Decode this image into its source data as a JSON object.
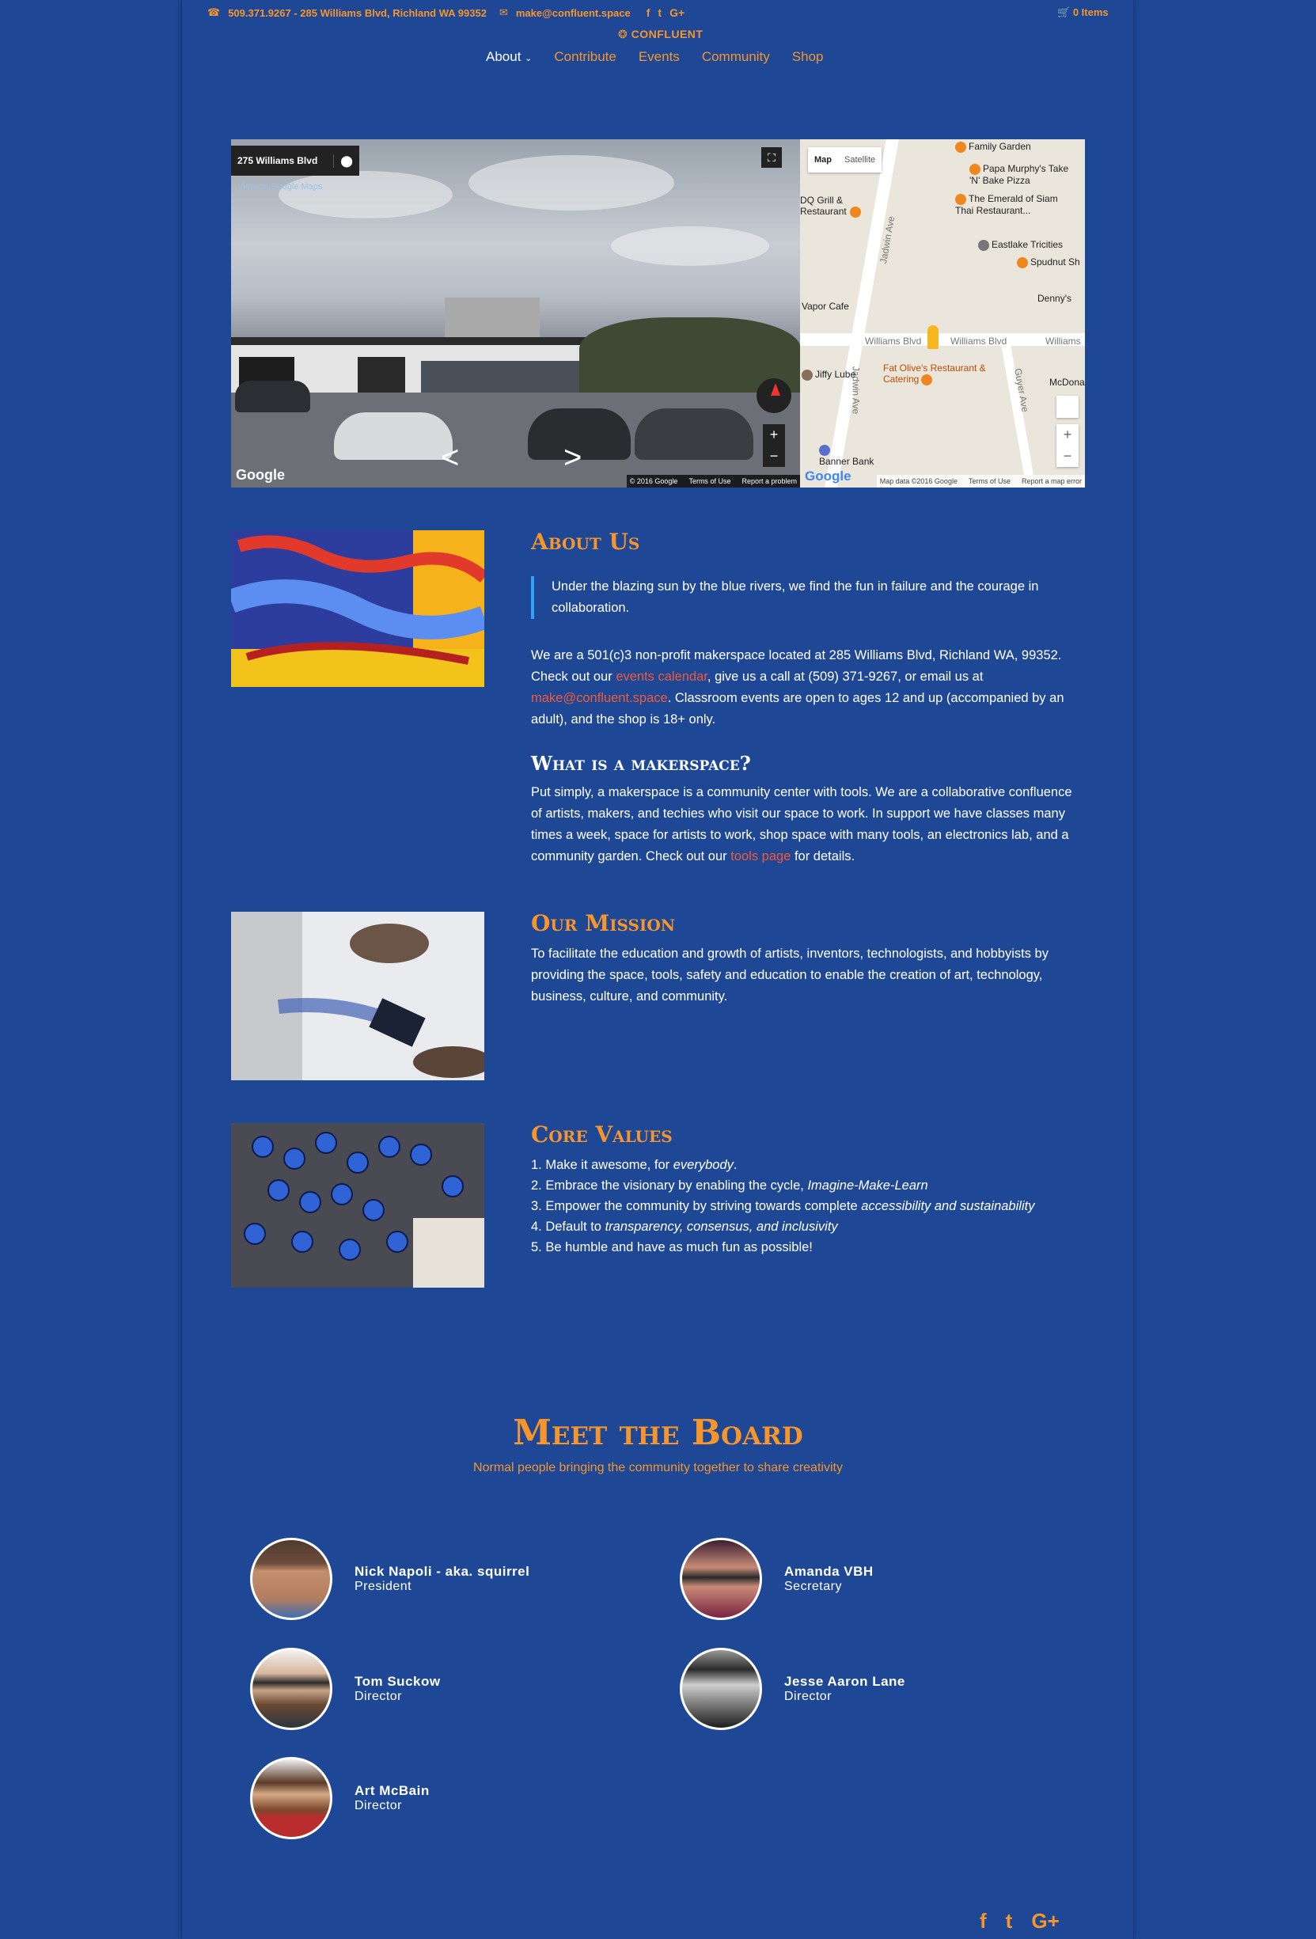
{
  "topbar": {
    "phone_address": "509.371.9267 - 285 Williams Blvd, Richland WA 99352",
    "email": "make@confluent.space",
    "social": [
      "f",
      "t",
      "G+"
    ],
    "cart": "0 Items"
  },
  "logo": "CONFLUENT",
  "nav": [
    {
      "label": "About"
    },
    {
      "label": "Contribute"
    },
    {
      "label": "Events"
    },
    {
      "label": "Community"
    },
    {
      "label": "Shop"
    }
  ],
  "map": {
    "streetview": {
      "address": "275 Williams Blvd",
      "view_link": "View on Google Maps",
      "copyright": "© 2016 Google",
      "terms": "Terms of Use",
      "report": "Report a problem",
      "google": "Google"
    },
    "map_view": {
      "tab_map": "Map",
      "tab_satellite": "Satellite",
      "pois": [
        "Family Garden",
        "Papa Murphy's Take 'N' Bake Pizza",
        "DQ Grill & Restaurant",
        "The Emerald of Siam Thai Restaurant...",
        "Eastlake Tricities",
        "Spudnut Sh",
        "Denny's",
        "Vapor Cafe",
        "Williams Blvd",
        "Williams Blvd",
        "Williams",
        "Jadwin Ave",
        "Jadwin Ave",
        "Fat Olive's Restaurant & Catering",
        "Jiffy Lube",
        "McDona",
        "Guyer Ave",
        "Banner Bank"
      ],
      "data": "Map data ©2016 Google",
      "terms": "Terms of Use",
      "report": "Report a map error",
      "google": "Google"
    }
  },
  "about": {
    "title": "About Us",
    "quote": "Under the blazing sun by the blue rivers, we find the fun in failure and the courage in collaboration.",
    "p1_a": "We are a 501(c)3 non-profit makerspace located at 285 Williams Blvd, Richland WA, 99352. Check out our ",
    "p1_link1": "events calendar",
    "p1_b": ", give us a call at (509) 371-9267, or email us at ",
    "p1_link2": "make@confluent.space",
    "p1_c": ". Classroom events are open to ages 12 and up (accompanied by an adult), and the shop is 18+ only.",
    "makerspace_title": "What is a makerspace?",
    "p2_a": "Put simply, a makerspace is a community center with tools. We are a collaborative confluence of artists, makers, and techies who visit our space to work. In support we have classes many times a week, space for artists to work, shop space with many tools, an electronics lab, and a community garden. Check out our ",
    "p2_link": "tools page",
    "p2_b": " for details."
  },
  "mission": {
    "title": "Our Mission",
    "text": "To facilitate the education and growth of artists, inventors, technologists, and hobbyists by providing the space, tools, safety and education to enable the creation of art, technology, business, culture, and community."
  },
  "values": {
    "title": "Core Values",
    "items": [
      {
        "a": "1. Make it awesome, for ",
        "em": "everybody",
        "b": "."
      },
      {
        "a": "2. Embrace the visionary by enabling the cycle, ",
        "em": "Imagine-Make-Learn",
        "b": ""
      },
      {
        "a": "3. Empower the community by striving towards complete ",
        "em": "accessibility and sustainability",
        "b": ""
      },
      {
        "a": "4. Default to ",
        "em": "transparency, consensus, and inclusivity",
        "b": ""
      },
      {
        "a": "5. Be humble and have as much fun as possible!",
        "em": "",
        "b": ""
      }
    ]
  },
  "board": {
    "title": "Meet the Board",
    "subtitle": "Normal people bringing the community together to share creativity",
    "members": [
      {
        "name": "Nick Napoli - aka. squirrel",
        "role": "President"
      },
      {
        "name": "Amanda VBH",
        "role": "Secretary"
      },
      {
        "name": "Tom Suckow",
        "role": "Director"
      },
      {
        "name": "Jesse Aaron Lane",
        "role": "Director"
      },
      {
        "name": "Art McBain",
        "role": "Director"
      }
    ]
  },
  "footer": {
    "social": [
      "f",
      "t",
      "G+"
    ]
  }
}
